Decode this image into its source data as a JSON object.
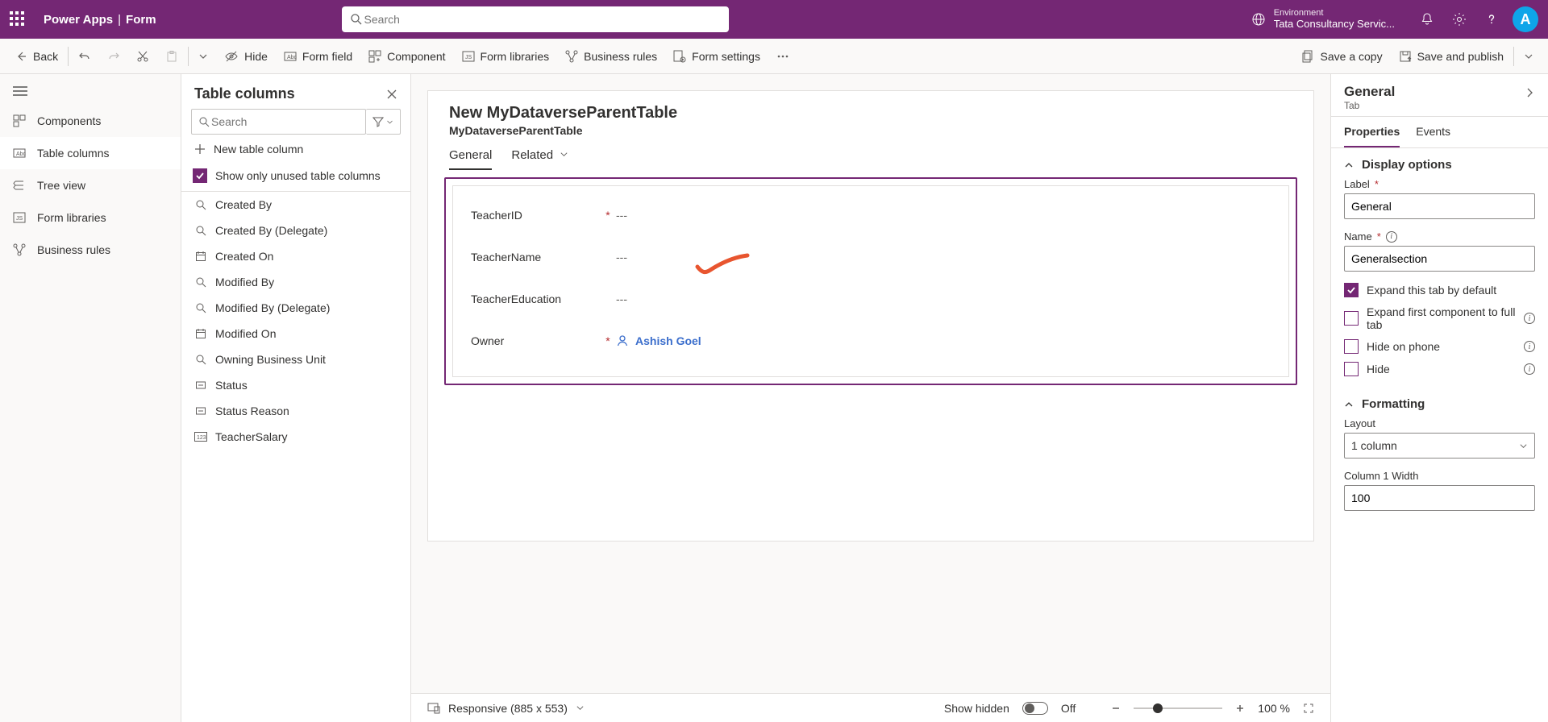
{
  "header": {
    "app": "Power Apps",
    "page": "Form",
    "search_placeholder": "Search",
    "env_label": "Environment",
    "env_value": "Tata Consultancy Servic...",
    "avatar_initial": "A"
  },
  "commandbar": {
    "back": "Back",
    "hide": "Hide",
    "form_field": "Form field",
    "component": "Component",
    "form_libraries": "Form libraries",
    "business_rules": "Business rules",
    "form_settings": "Form settings",
    "save_copy": "Save a copy",
    "save_publish": "Save and publish"
  },
  "leftrail": {
    "items": [
      {
        "label": "Components"
      },
      {
        "label": "Table columns"
      },
      {
        "label": "Tree view"
      },
      {
        "label": "Form libraries"
      },
      {
        "label": "Business rules"
      }
    ]
  },
  "colpanel": {
    "title": "Table columns",
    "search_placeholder": "Search",
    "new_col": "New table column",
    "unused_label": "Show only unused table columns",
    "columns": [
      {
        "icon": "lookup",
        "label": "Created By"
      },
      {
        "icon": "lookup",
        "label": "Created By (Delegate)"
      },
      {
        "icon": "date",
        "label": "Created On"
      },
      {
        "icon": "lookup",
        "label": "Modified By"
      },
      {
        "icon": "lookup",
        "label": "Modified By (Delegate)"
      },
      {
        "icon": "date",
        "label": "Modified On"
      },
      {
        "icon": "lookup",
        "label": "Owning Business Unit"
      },
      {
        "icon": "option",
        "label": "Status"
      },
      {
        "icon": "option",
        "label": "Status Reason"
      },
      {
        "icon": "number",
        "label": "TeacherSalary"
      }
    ]
  },
  "form": {
    "title": "New MyDataverseParentTable",
    "subtitle": "MyDataverseParentTable",
    "tabs": {
      "general": "General",
      "related": "Related"
    },
    "fields": [
      {
        "label": "TeacherID",
        "required": true,
        "value": "---"
      },
      {
        "label": "TeacherName",
        "required": false,
        "value": "---"
      },
      {
        "label": "TeacherEducation",
        "required": false,
        "value": "---"
      }
    ],
    "owner_label": "Owner",
    "owner_value": "Ashish Goel",
    "footer": {
      "view": "Responsive (885 x 553)",
      "show_hidden": "Show hidden",
      "toggle_state": "Off",
      "zoom": "100 %"
    }
  },
  "props": {
    "title": "General",
    "subtitle": "Tab",
    "tab_props": "Properties",
    "tab_events": "Events",
    "display": {
      "title": "Display options",
      "label_lbl": "Label",
      "label_val": "General",
      "name_lbl": "Name",
      "name_val": "Generalsection",
      "chk_expand": "Expand this tab by default",
      "chk_first": "Expand first component to full tab",
      "chk_phone": "Hide on phone",
      "chk_hide": "Hide"
    },
    "formatting": {
      "title": "Formatting",
      "layout_lbl": "Layout",
      "layout_val": "1 column",
      "col_w_lbl": "Column 1 Width",
      "col_w_val": "100"
    }
  }
}
